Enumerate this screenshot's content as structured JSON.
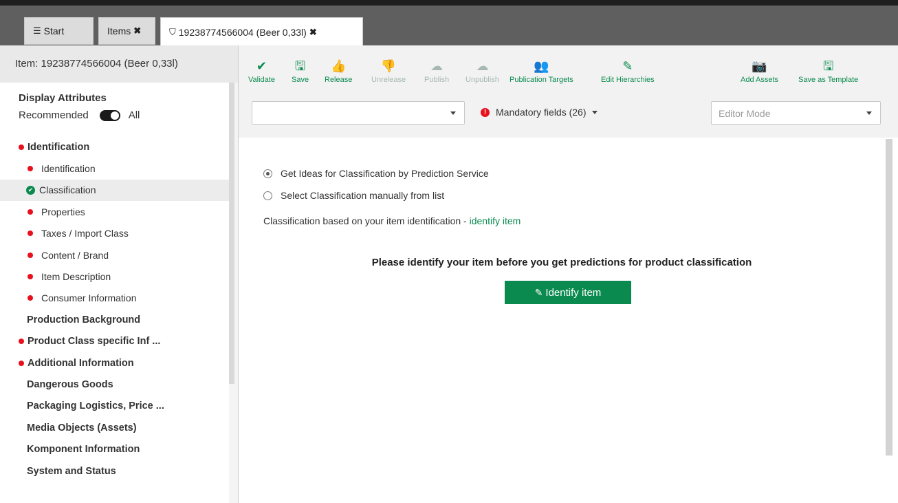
{
  "tabs": [
    {
      "label": "Start",
      "icon": "menu-icon"
    },
    {
      "label": "Items",
      "icon": "close-icon"
    },
    {
      "label": "19238774566004 (Beer 0,33l)",
      "icon": "tag-icon"
    }
  ],
  "sidebar": {
    "header": "Item: 19238774566004 (Beer 0,33l)",
    "display_attributes": "Display Attributes",
    "recommended": "Recommended",
    "all": "All",
    "items": [
      {
        "label": "Identification",
        "level": "top",
        "status": "error"
      },
      {
        "label": "Identification",
        "level": "sub",
        "status": "error"
      },
      {
        "label": "Classification",
        "level": "sub",
        "status": "ok"
      },
      {
        "label": "Properties",
        "level": "sub",
        "status": "error"
      },
      {
        "label": "Taxes / Import Class",
        "level": "sub",
        "status": "error"
      },
      {
        "label": "Content / Brand",
        "level": "sub",
        "status": "error"
      },
      {
        "label": "Item Description",
        "level": "sub",
        "status": "error"
      },
      {
        "label": "Consumer Information",
        "level": "sub",
        "status": "error"
      },
      {
        "label": "Production Background",
        "level": "top",
        "status": "none"
      },
      {
        "label": "Product Class specific Inf ...",
        "level": "top",
        "status": "error"
      },
      {
        "label": "Additional Information",
        "level": "top",
        "status": "error"
      },
      {
        "label": "Dangerous Goods",
        "level": "top",
        "status": "none"
      },
      {
        "label": "Packaging Logistics, Price ...",
        "level": "top",
        "status": "none"
      },
      {
        "label": "Media Objects (Assets)",
        "level": "top",
        "status": "none"
      },
      {
        "label": "Komponent Information",
        "level": "top",
        "status": "none"
      },
      {
        "label": "System and Status",
        "level": "top",
        "status": "none"
      }
    ]
  },
  "toolbar": {
    "validate": "Validate",
    "save": "Save",
    "release": "Release",
    "unrelease": "Unrelease",
    "publish": "Publish",
    "unpublish": "Unpublish",
    "publication_targets": "Publication Targets",
    "edit_hierarchies": "Edit Hierarchies",
    "add_assets": "Add Assets",
    "save_as_template": "Save as Template"
  },
  "filters": {
    "select_value": "",
    "mandatory": "Mandatory fields (26)",
    "editor_mode_placeholder": "Editor Mode"
  },
  "main": {
    "option_prediction": "Get Ideas for Classification by Prediction Service",
    "option_manual": "Select Classification manually from list",
    "classification_text": "Classification based on your item identification - ",
    "identify_link": "identify item",
    "please_text": "Please identify your item before you get predictions for product classification",
    "identify_button": "Identify item"
  },
  "colors": {
    "accent": "#0b8a4f",
    "error": "#e8101c"
  }
}
